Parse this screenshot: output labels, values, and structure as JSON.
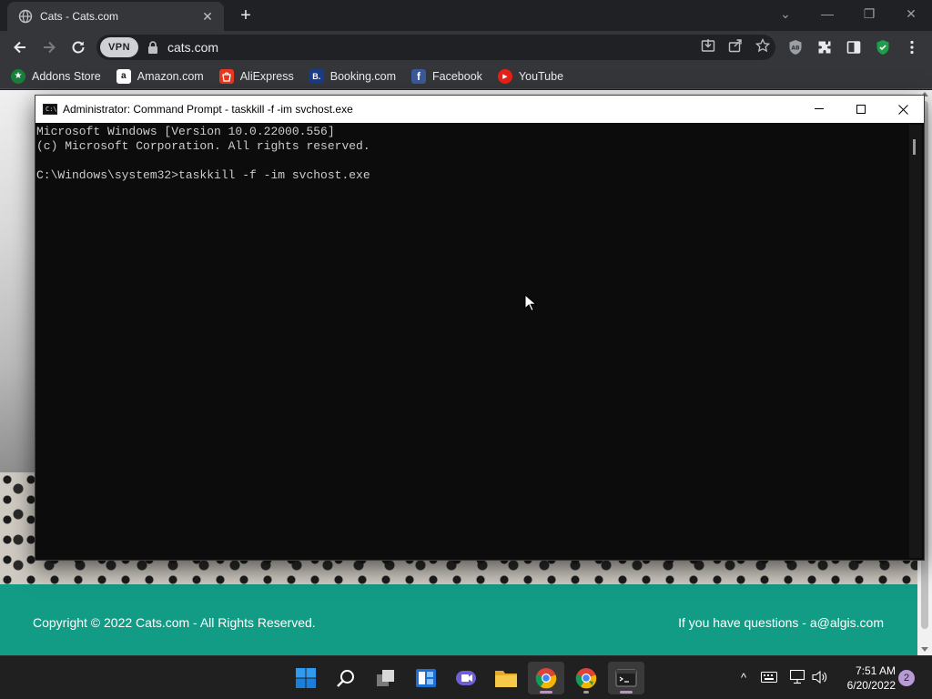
{
  "browser": {
    "tab": {
      "title": "Cats - Cats.com",
      "close": "✕"
    },
    "new_tab": "+",
    "window_controls": {
      "chevron": "⌄",
      "minimize": "—",
      "restore": "❐",
      "close": "✕"
    },
    "omnibox": {
      "vpn_label": "VPN",
      "url": "cats.com"
    }
  },
  "bookmarks": [
    {
      "label": "Addons Store",
      "icon": "addons-store-icon",
      "color": "#1a7d3c",
      "glyph": "★"
    },
    {
      "label": "Amazon.com",
      "icon": "amazon-icon",
      "color": "#ffffff",
      "glyph": "a"
    },
    {
      "label": "AliExpress",
      "icon": "aliexpress-icon",
      "color": "#e8381d",
      "glyph": "🛍"
    },
    {
      "label": "Booking.com",
      "icon": "booking-icon",
      "color": "#1b3a8a",
      "glyph": "B."
    },
    {
      "label": "Facebook",
      "icon": "facebook-icon",
      "color": "#3b5998",
      "glyph": "f"
    },
    {
      "label": "YouTube",
      "icon": "youtube-icon",
      "color": "#e62117",
      "glyph": "▶"
    }
  ],
  "page": {
    "footer_copyright": "Copyright © 2022 Cats.com - All Rights Reserved.",
    "footer_contact": "If you have questions - a@algis.com",
    "footer_color": "#139c85"
  },
  "cmd": {
    "title": "Administrator: Command Prompt - taskkill  -f -im svchost.exe",
    "lines": [
      "Microsoft Windows [Version 10.0.22000.556]",
      "(c) Microsoft Corporation. All rights reserved.",
      "",
      "C:\\Windows\\system32>taskkill -f -im svchost.exe"
    ]
  },
  "taskbar": {
    "time": "7:51 AM",
    "date": "6/20/2022",
    "notification_count": "2",
    "tray_up": "^"
  }
}
